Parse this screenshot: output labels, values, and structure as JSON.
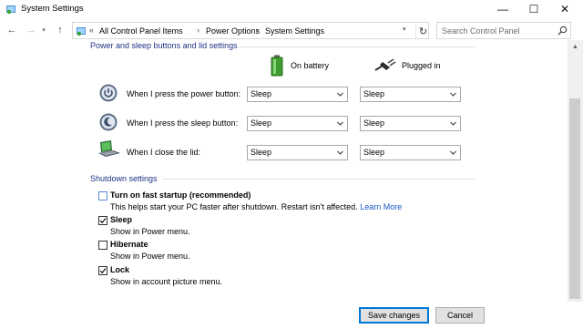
{
  "window": {
    "title": "System Settings",
    "controls": {
      "minimize": "—",
      "maximize": "☐",
      "close": "✕"
    }
  },
  "nav": {
    "back": "←",
    "forward": "→",
    "recent": "▾",
    "up": "↑",
    "breadcrumb_prefix": "«",
    "breadcrumbs": [
      "All Control Panel Items",
      "Power Options",
      "System Settings"
    ],
    "separator": "›",
    "address_dropdown": "▾",
    "refresh": "↻",
    "search_placeholder": "Search Control Panel"
  },
  "power_section": {
    "heading": "Power and sleep buttons and lid settings",
    "col_battery": "On battery",
    "col_plugged": "Plugged in",
    "rows": [
      {
        "label": "When I press the power button:",
        "icon": "power-button-icon",
        "battery": "Sleep",
        "plugged": "Sleep"
      },
      {
        "label": "When I press the sleep button:",
        "icon": "sleep-button-icon",
        "battery": "Sleep",
        "plugged": "Sleep"
      },
      {
        "label": "When I close the lid:",
        "icon": "laptop-lid-icon",
        "battery": "Sleep",
        "plugged": "Sleep"
      }
    ]
  },
  "shutdown_section": {
    "heading": "Shutdown settings",
    "options": [
      {
        "title": "Turn on fast startup (recommended)",
        "desc": "This helps start your PC faster after shutdown. Restart isn't affected.",
        "link": "Learn More",
        "checked": false
      },
      {
        "title": "Sleep",
        "desc": "Show in Power menu.",
        "checked": true
      },
      {
        "title": "Hibernate",
        "desc": "Show in Power menu.",
        "checked": false
      },
      {
        "title": "Lock",
        "desc": "Show in account picture menu.",
        "checked": true
      }
    ]
  },
  "buttons": {
    "save": "Save changes",
    "cancel": "Cancel"
  },
  "colors": {
    "heading_blue": "#1e3287",
    "link_blue": "#1a57c8",
    "focus_blue": "#0078d7"
  }
}
